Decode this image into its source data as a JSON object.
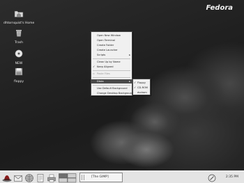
{
  "brand": {
    "text": "Fedora"
  },
  "desktop_icons": [
    {
      "label": "dhtornquist's Home",
      "icon": "home-folder-icon"
    },
    {
      "label": "Trash",
      "icon": "trash-icon"
    },
    {
      "label": "NEW",
      "icon": "cd-disc-icon"
    },
    {
      "label": "floppy",
      "icon": "floppy-drive-icon"
    }
  ],
  "context_menu": {
    "items": [
      "Open New Window",
      "Open Terminal",
      "Create Folder",
      "Create Launcher",
      "Scripts",
      "Clean Up by Name",
      "Keep Aligned",
      "Paste Files",
      "Disks",
      "Use Default Background",
      "Change Desktop Background"
    ],
    "submenu_arrow": "▸",
    "check_mark": "✓"
  },
  "disks_submenu": {
    "items": [
      "Floppy",
      "CD-ROM",
      "dvdrom"
    ]
  },
  "panel": {
    "launchers": [
      "fedora-hat-icon",
      "email-icon",
      "web-browser-icon",
      "office-icon",
      "printer-icon",
      "workspace-switcher-icon"
    ],
    "task": {
      "label": "[The GIMP]"
    },
    "clock": "2:35 PM"
  },
  "colors": {
    "menu_background": "#f0f0f0",
    "menu_highlight": "#4a4a4a",
    "panel_background": "#e4e4e4",
    "desktop_background": "#222222"
  }
}
